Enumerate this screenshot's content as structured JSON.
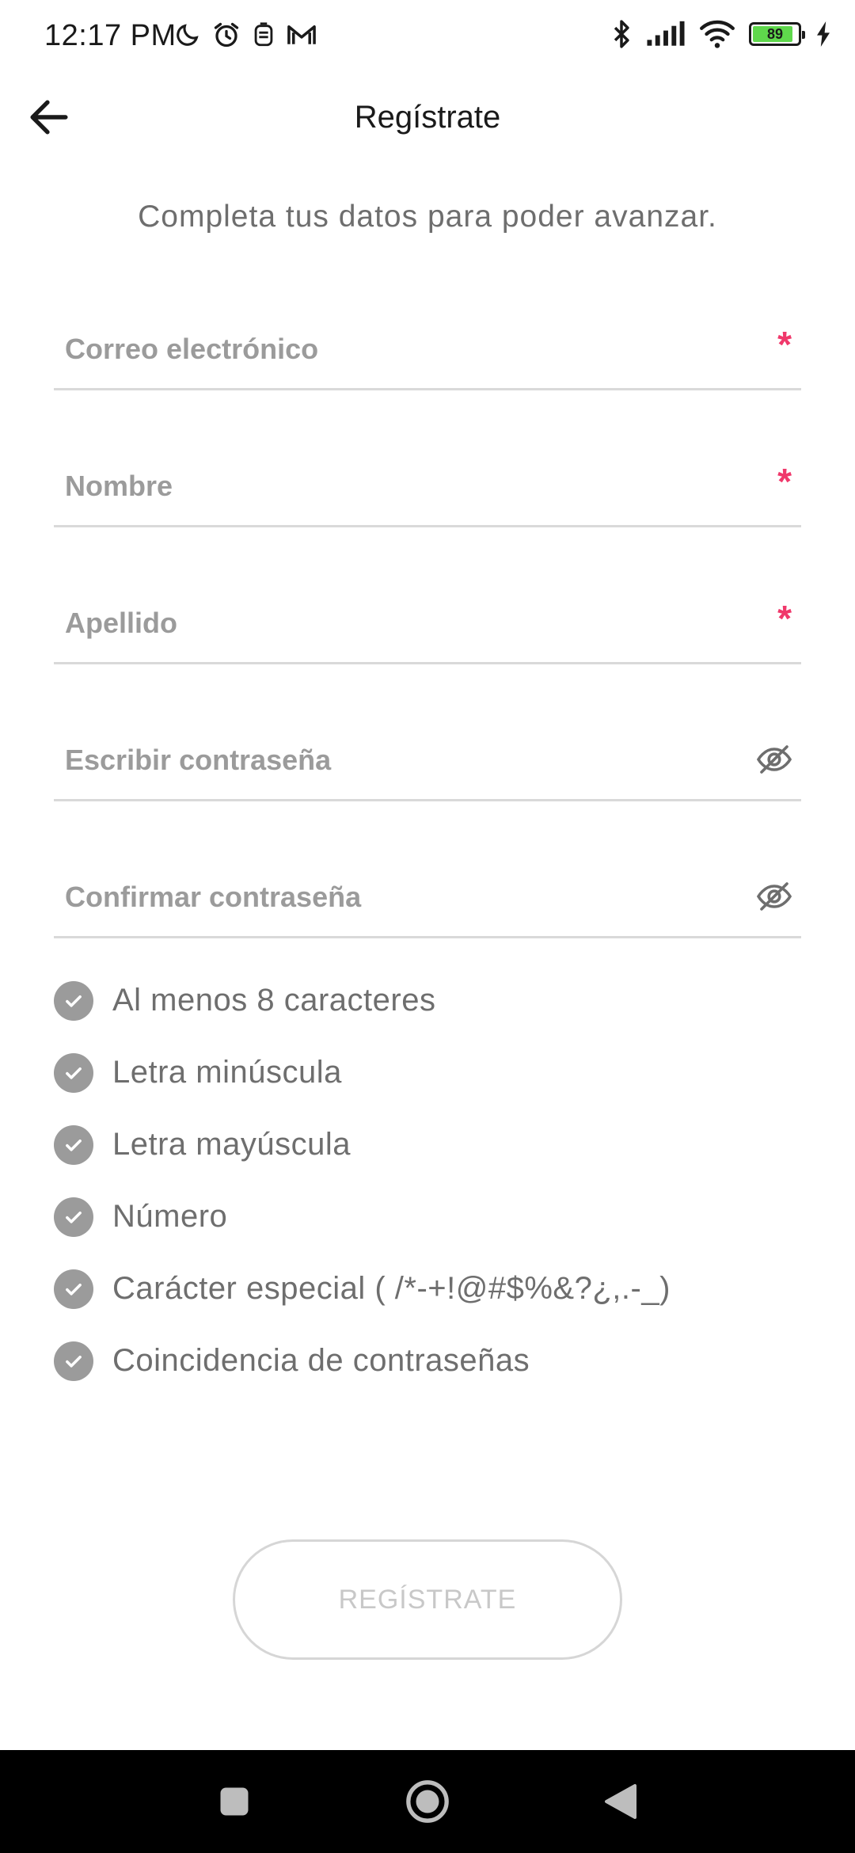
{
  "status_bar": {
    "time": "12:17 PM",
    "battery_level": "89",
    "left_icons": [
      "moon-icon",
      "alarm-icon",
      "notification-app-icon",
      "gmail-icon"
    ],
    "right_icons": [
      "bluetooth-icon",
      "signal-icon",
      "wifi-icon",
      "battery-icon",
      "charging-icon"
    ]
  },
  "header": {
    "title": "Regístrate",
    "back_icon": "arrow-left-icon"
  },
  "subtitle": "Completa tus datos para poder avanzar.",
  "form": {
    "email": {
      "placeholder": "Correo electrónico",
      "value": "",
      "required_mark": "*"
    },
    "first_name": {
      "placeholder": "Nombre",
      "value": "",
      "required_mark": "*"
    },
    "last_name": {
      "placeholder": "Apellido",
      "value": "",
      "required_mark": "*"
    },
    "password": {
      "placeholder": "Escribir contraseña",
      "value": "",
      "toggle_icon": "eye-off-icon"
    },
    "confirm_password": {
      "placeholder": "Confirmar contraseña",
      "value": "",
      "toggle_icon": "eye-off-icon"
    }
  },
  "requirements": [
    "Al menos 8 caracteres",
    "Letra minúscula",
    "Letra mayúscula",
    "Número",
    "Carácter especial ( /*-+!@#$%&?¿,.-_)",
    "Coincidencia de contraseñas"
  ],
  "submit_button": {
    "label": "REGÍSTRATE",
    "enabled": false
  },
  "colors": {
    "required": "#f0386b",
    "check_inactive": "#9b9b9b",
    "divider": "#d9d9d9",
    "battery_fill": "#5fd84c"
  },
  "nav_bar": {
    "buttons": [
      "recents-square-icon",
      "home-circle-icon",
      "back-triangle-icon"
    ]
  }
}
